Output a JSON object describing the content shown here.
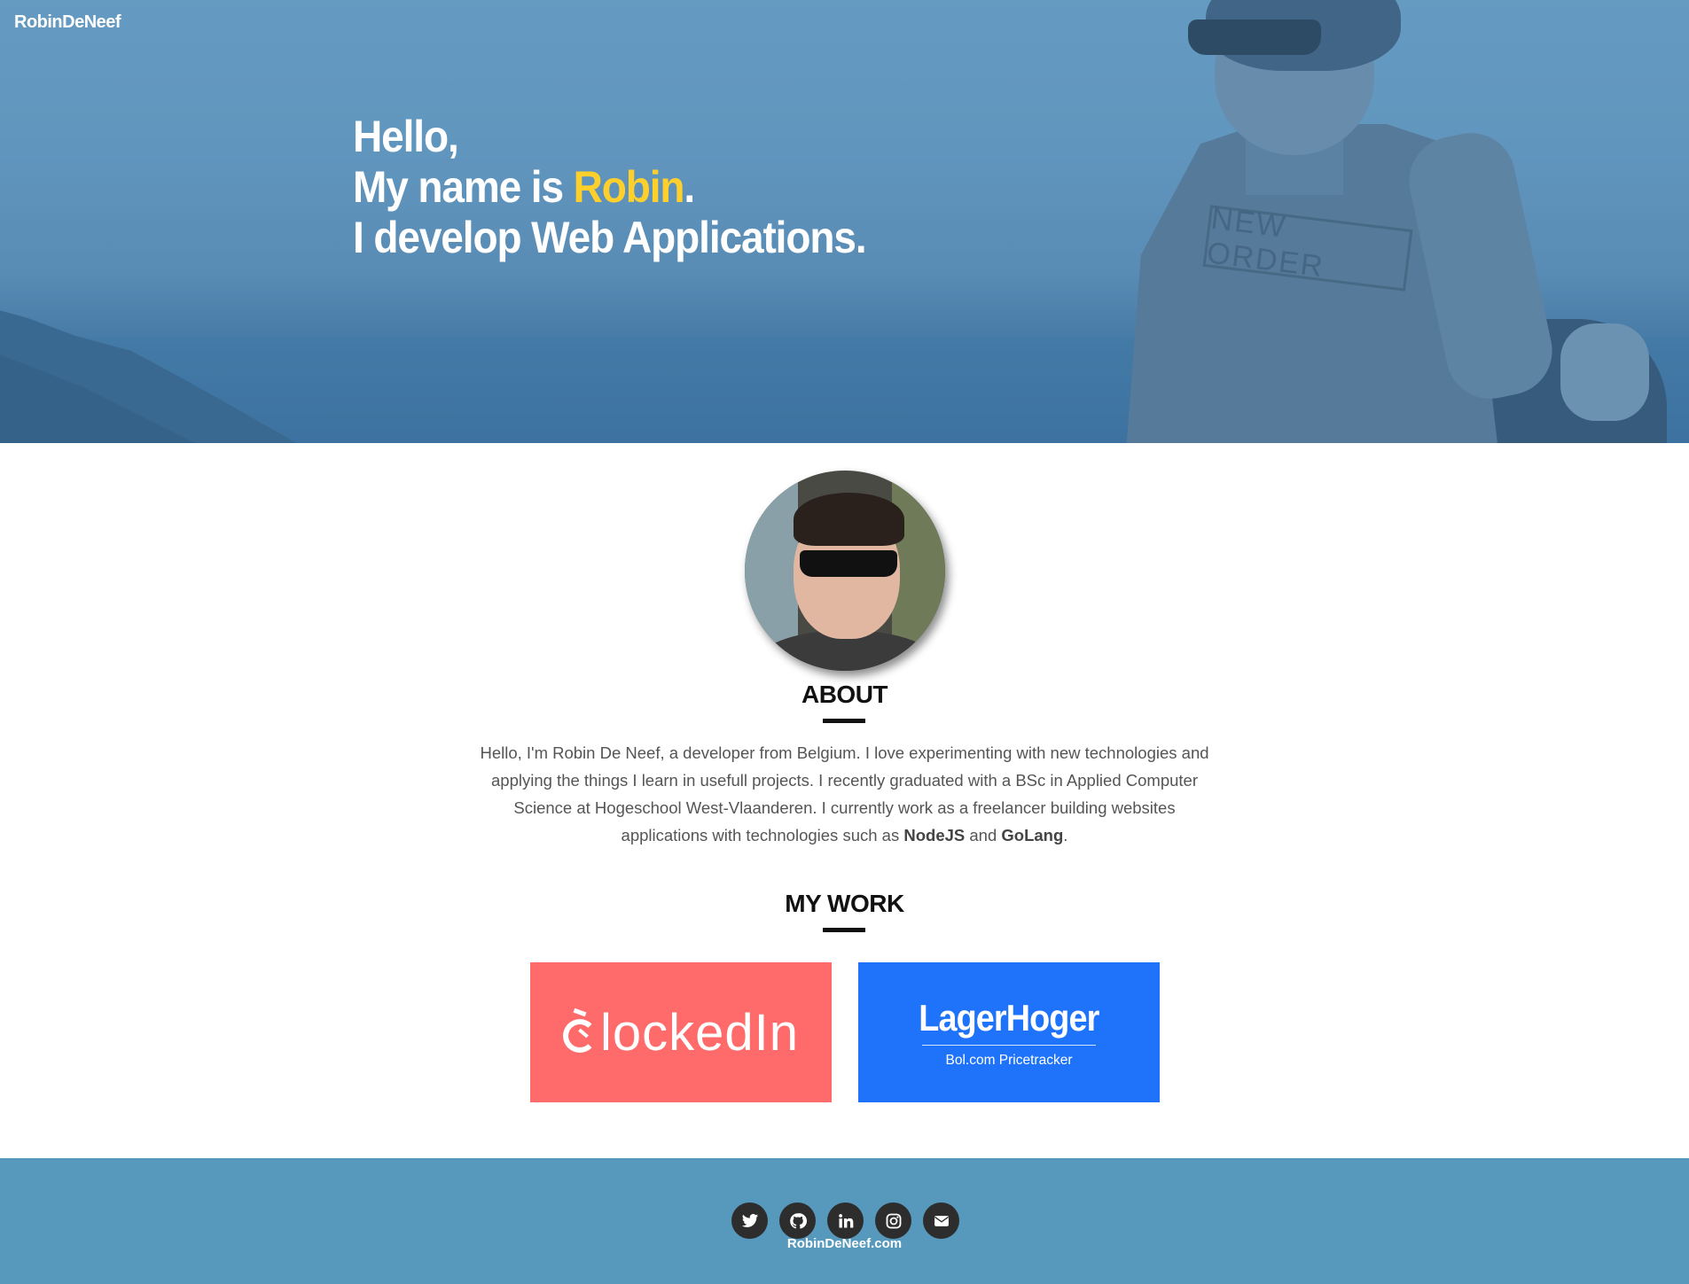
{
  "header": {
    "brand": "RobinDeNeef"
  },
  "hero": {
    "line1": "Hello,",
    "line2_prefix": "My name is ",
    "line2_name": "Robin",
    "line2_suffix": ".",
    "line3": "I develop Web Applications.",
    "shirt_print": "NEW ORDER",
    "accent_color": "#ffd02b"
  },
  "about": {
    "title": "ABOUT",
    "text_part1": "Hello, I'm Robin De Neef, a developer from Belgium. I love experimenting with new technologies and applying the things I learn in usefull projects. I recently graduated with a BSc in Applied Computer Science at Hogeschool West-Vlaanderen. I currently work as a freelancer building websites applications with technologies such as ",
    "tech1": "NodeJS",
    "text_and": " and ",
    "tech2": "GoLang",
    "text_end": "."
  },
  "work": {
    "title": "MY WORK",
    "projects": [
      {
        "name": "ClockedIn",
        "logo_text": "lockedIn",
        "color": "#ff6b6b"
      },
      {
        "name": "LagerHoger",
        "subtitle": "Bol.com Pricetracker",
        "color": "#1e73fa"
      }
    ]
  },
  "footer": {
    "social": [
      {
        "icon": "twitter-icon"
      },
      {
        "icon": "github-icon"
      },
      {
        "icon": "linkedin-icon"
      },
      {
        "icon": "instagram-icon"
      },
      {
        "icon": "envelope-icon"
      }
    ],
    "site": "RobinDeNeef.com",
    "background": "#5799bc"
  }
}
